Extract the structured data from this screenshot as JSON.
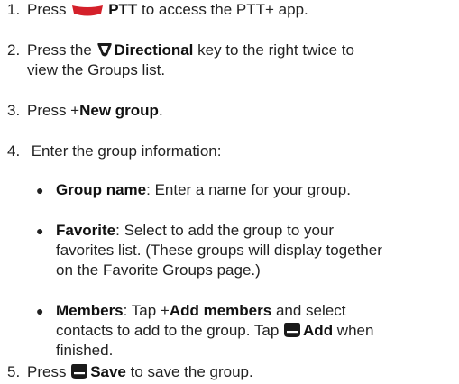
{
  "steps": {
    "s1": {
      "num": "1.",
      "pre": "Press ",
      "bold": "PTT",
      "post": " to access the PTT+ app."
    },
    "s2": {
      "num": "2.",
      "pre": "Press the ",
      "bold": "Directional",
      "post": " key to the right twice to",
      "cont": "view the Groups list."
    },
    "s3": {
      "num": "3.",
      "pre": "Press +",
      "bold": "New group",
      "post": "."
    },
    "s4": {
      "num": "4.",
      "text": " Enter the group information:"
    },
    "s5": {
      "num": "5.",
      "pre": "Press ",
      "bold": "Save",
      "post": " to save the group."
    }
  },
  "bullets": {
    "b1": {
      "bold": "Group name",
      "text": ": Enter a name for your group."
    },
    "b2": {
      "bold": "Favorite",
      "line1": ": Select to add the group to your",
      "line2": "favorites list. (These groups will display together",
      "line3": "on the Favorite Groups page.)"
    },
    "b3": {
      "bold": "Members",
      "line1a": ": Tap +",
      "bold2": "Add members",
      "line1b": " and select",
      "line2a": "contacts to add to the group. Tap ",
      "bold3": "Add",
      "line2b": " when",
      "line3": "finished."
    }
  },
  "bullet_char": "●",
  "colors": {
    "ptt_key": "#d4202a",
    "soft_key": "#1a1a1a",
    "text": "#222222"
  },
  "icons": {
    "ptt": "ptt-key-icon",
    "directional": "directional-key-icon",
    "softkey": "soft-key-icon"
  }
}
